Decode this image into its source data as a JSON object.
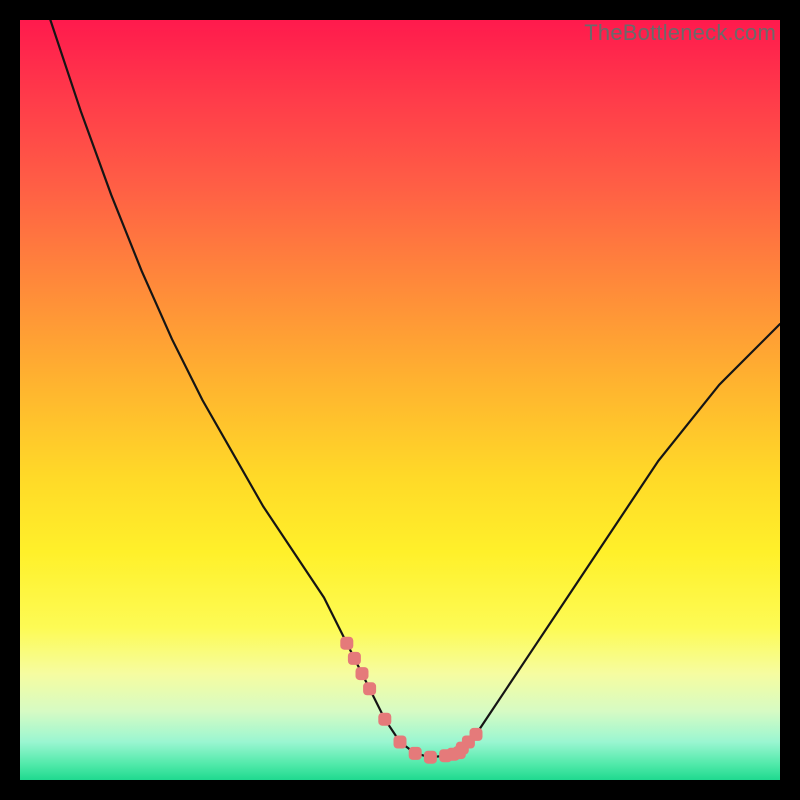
{
  "watermark": "TheBottleneck.com",
  "colors": {
    "frame": "#000000",
    "curve": "#151515",
    "marker": "#e57a7a",
    "gradient_top": "#ff1a4d",
    "gradient_bottom": "#1fd98f"
  },
  "chart_data": {
    "type": "line",
    "title": "",
    "xlabel": "",
    "ylabel": "",
    "xlim": [
      0,
      100
    ],
    "ylim": [
      0,
      100
    ],
    "grid": false,
    "legend": false,
    "x": [
      4,
      8,
      12,
      16,
      20,
      24,
      28,
      32,
      36,
      40,
      43,
      44,
      45,
      46,
      48,
      50,
      52,
      54,
      56,
      57,
      58,
      60,
      62,
      64,
      68,
      72,
      76,
      80,
      84,
      88,
      92,
      96,
      100
    ],
    "values": [
      100,
      88,
      77,
      67,
      58,
      50,
      43,
      36,
      30,
      24,
      18,
      16,
      14,
      12,
      8,
      5,
      3.5,
      3,
      3.2,
      3.4,
      4,
      6,
      9,
      12,
      18,
      24,
      30,
      36,
      42,
      47,
      52,
      56,
      60
    ],
    "annotations": {
      "marker_color": "#e57a7a",
      "marker_positions_x": [
        43,
        44,
        45,
        46,
        48,
        50,
        52,
        54,
        56,
        57,
        57.8,
        58.2,
        59,
        60
      ],
      "marker_positions_y": [
        18,
        16,
        14,
        12,
        8,
        5,
        3.5,
        3,
        3.2,
        3.4,
        3.6,
        4.2,
        5,
        6
      ]
    },
    "background": {
      "type": "vertical-gradient",
      "stops": [
        {
          "pos": 0,
          "color": "#ff1a4d"
        },
        {
          "pos": 35,
          "color": "#ff8a3a"
        },
        {
          "pos": 70,
          "color": "#fff02a"
        },
        {
          "pos": 100,
          "color": "#1fd98f"
        }
      ]
    }
  }
}
